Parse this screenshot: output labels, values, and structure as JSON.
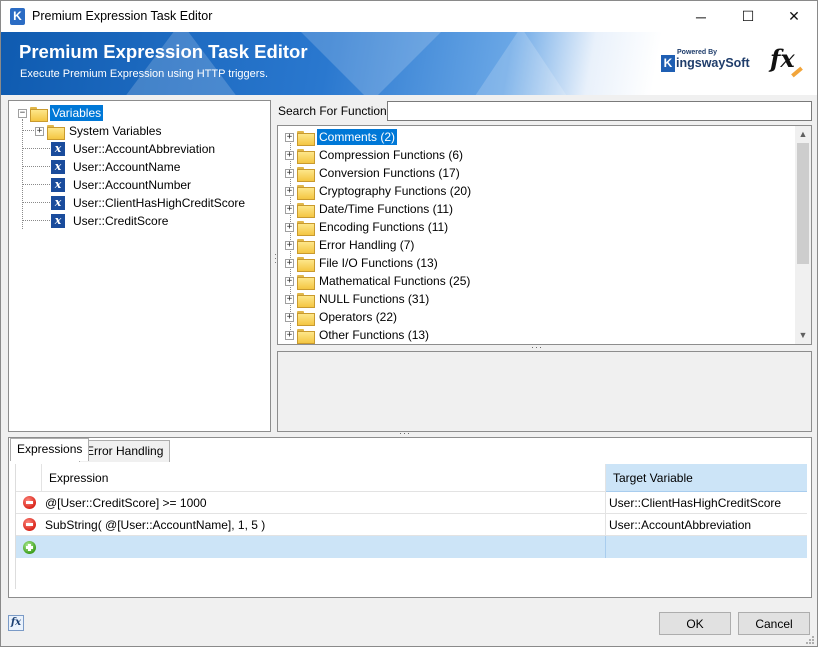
{
  "window": {
    "title": "Premium Expression Task Editor",
    "controls": {
      "minimize": "─",
      "maximize": "☐",
      "close": "✕"
    }
  },
  "banner": {
    "title": "Premium Expression Task Editor",
    "subtitle": "Execute Premium Expression using HTTP triggers.",
    "logo_powered": "Powered By",
    "logo_k": "K",
    "logo_text": "ingswaySoft",
    "fx_mark": "fx"
  },
  "variables": {
    "root_label": "Variables",
    "system_label": "System Variables",
    "items": [
      "User::AccountAbbreviation",
      "User::AccountName",
      "User::AccountNumber",
      "User::ClientHasHighCreditScore",
      "User::CreditScore"
    ]
  },
  "search": {
    "label": "Search For Function:",
    "value": ""
  },
  "functions": [
    "Comments (2)",
    "Compression Functions (6)",
    "Conversion Functions (17)",
    "Cryptography Functions (20)",
    "Date/Time Functions (11)",
    "Encoding Functions (11)",
    "Error Handling (7)",
    "File I/O Functions (13)",
    "Mathematical Functions (25)",
    "NULL Functions (31)",
    "Operators (22)",
    "Other Functions (13)"
  ],
  "tabs": {
    "expressions": "Expressions",
    "error_handling": "Error Handling"
  },
  "grid": {
    "col_expression": "Expression",
    "col_target": "Target Variable",
    "rows": [
      {
        "expression": "@[User::CreditScore] >= 1000",
        "target": "User::ClientHasHighCreditScore"
      },
      {
        "expression": "SubString( @[User::AccountName], 1, 5 )",
        "target": "User::AccountAbbreviation"
      }
    ]
  },
  "footer": {
    "fx_button": "fx",
    "ok": "OK",
    "cancel": "Cancel"
  },
  "colors": {
    "selection": "#0078d7",
    "header_highlight": "#cce4f7",
    "banner_blue": "#1f6fc6"
  }
}
